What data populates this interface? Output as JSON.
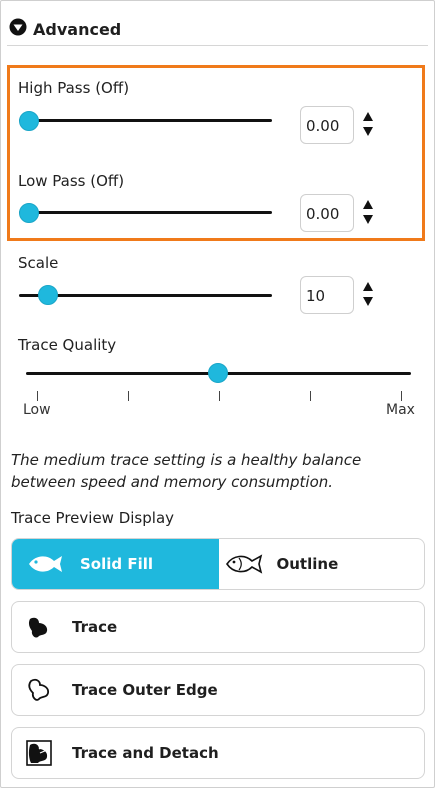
{
  "section": {
    "title": "Advanced",
    "icon": "chevron-down-circle-icon"
  },
  "high_pass": {
    "label": "High Pass (Off)",
    "value": "0.00",
    "slider_level": 0.0
  },
  "low_pass": {
    "label": "Low Pass (Off)",
    "value": "0.00",
    "slider_level": 0.0
  },
  "scale": {
    "label": "Scale",
    "value": "10",
    "slider_level": 0.12
  },
  "trace_quality": {
    "label": "Trace Quality",
    "min_label": "Low",
    "max_label": "Max",
    "slider_level": 0.5,
    "tick_count": 5
  },
  "description": "The medium trace setting is a healthy balance between speed and memory consumption.",
  "trace_preview": {
    "label": "Trace Preview Display",
    "solid_fill": "Solid Fill",
    "outline": "Outline",
    "selected": "Solid Fill"
  },
  "options": {
    "trace": "Trace",
    "trace_outer_edge": "Trace Outer Edge",
    "trace_and_detach": "Trace and Detach"
  },
  "colors": {
    "accent": "#1fb8dd",
    "highlight": "#f07a1a"
  }
}
